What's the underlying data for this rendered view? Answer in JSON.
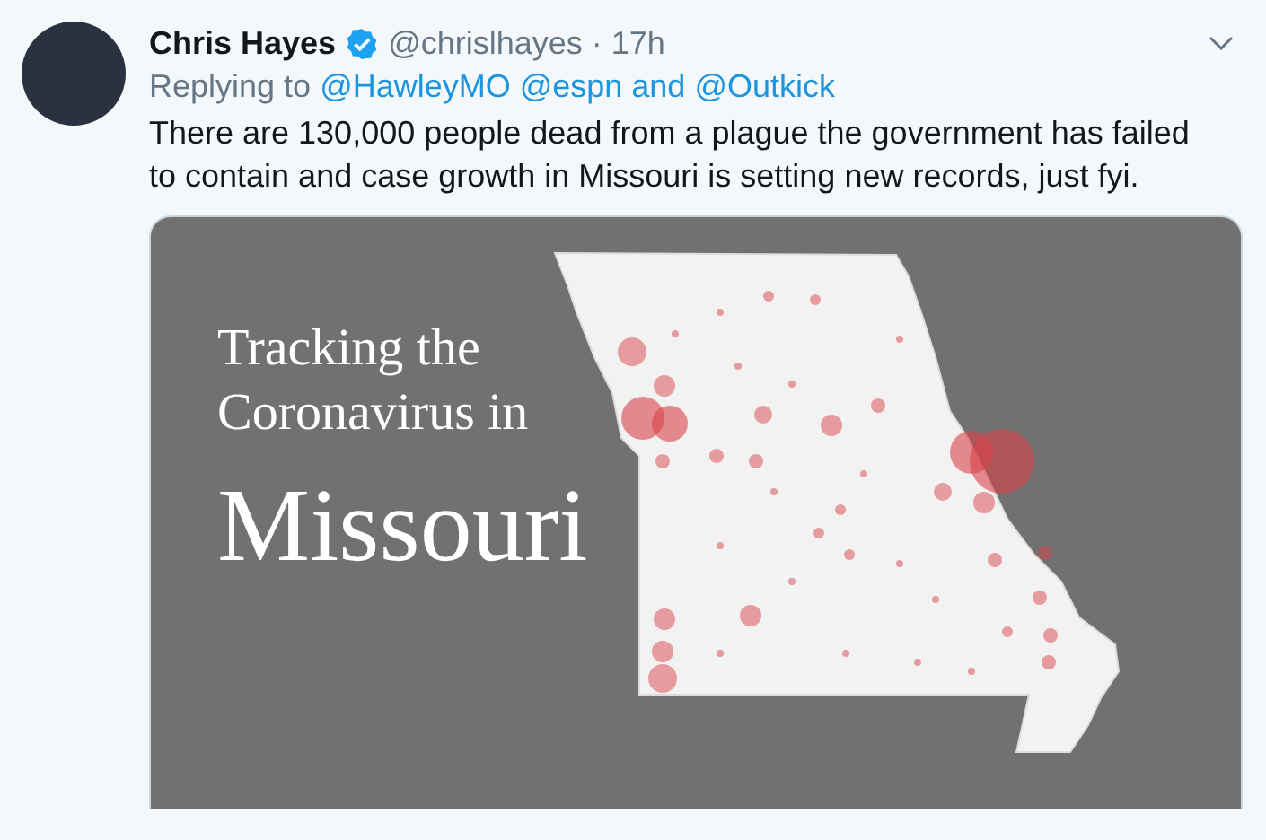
{
  "author": {
    "name": "Chris Hayes",
    "verified": true,
    "handle": "@chrislhayes",
    "separator": "·",
    "time": "17h"
  },
  "reply": {
    "label": "Replying to",
    "links": [
      "@HawleyMO",
      "@espn and @Outkick"
    ]
  },
  "text": "There are 130,000 people dead from a plague the government has failed to contain and case growth in Missouri is setting new records, just fyi.",
  "image": {
    "title_lines": [
      "Tracking the",
      "Coronavirus in"
    ],
    "headline": "Missouri"
  }
}
